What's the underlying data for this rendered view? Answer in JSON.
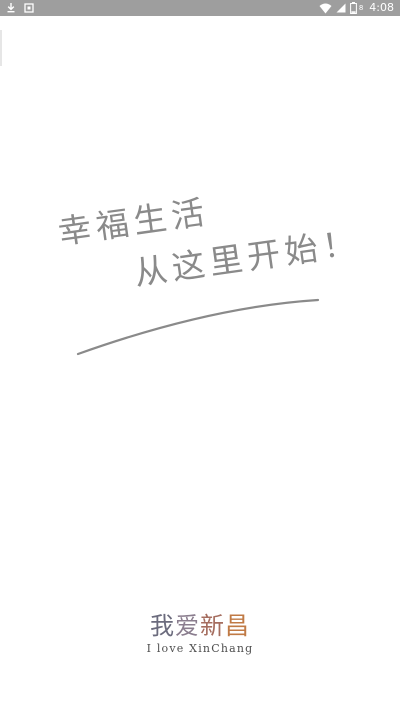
{
  "status_bar": {
    "time": "4:08",
    "battery_percent": "8",
    "icons": [
      "download-icon",
      "notification-icon",
      "wifi-icon",
      "cellular-signal-icon",
      "battery-icon"
    ]
  },
  "slogan": {
    "line1": "幸福生活",
    "line2": "从这里开始！"
  },
  "brand": {
    "chars": [
      "我",
      "爱",
      "新",
      "昌"
    ],
    "tagline": "I love XinChang"
  },
  "colors": {
    "status_bar_bg": "#9e9e9e",
    "background": "#ffffff",
    "slogan_text": "#8a8a8a",
    "brand_accent": "#c07a45"
  }
}
